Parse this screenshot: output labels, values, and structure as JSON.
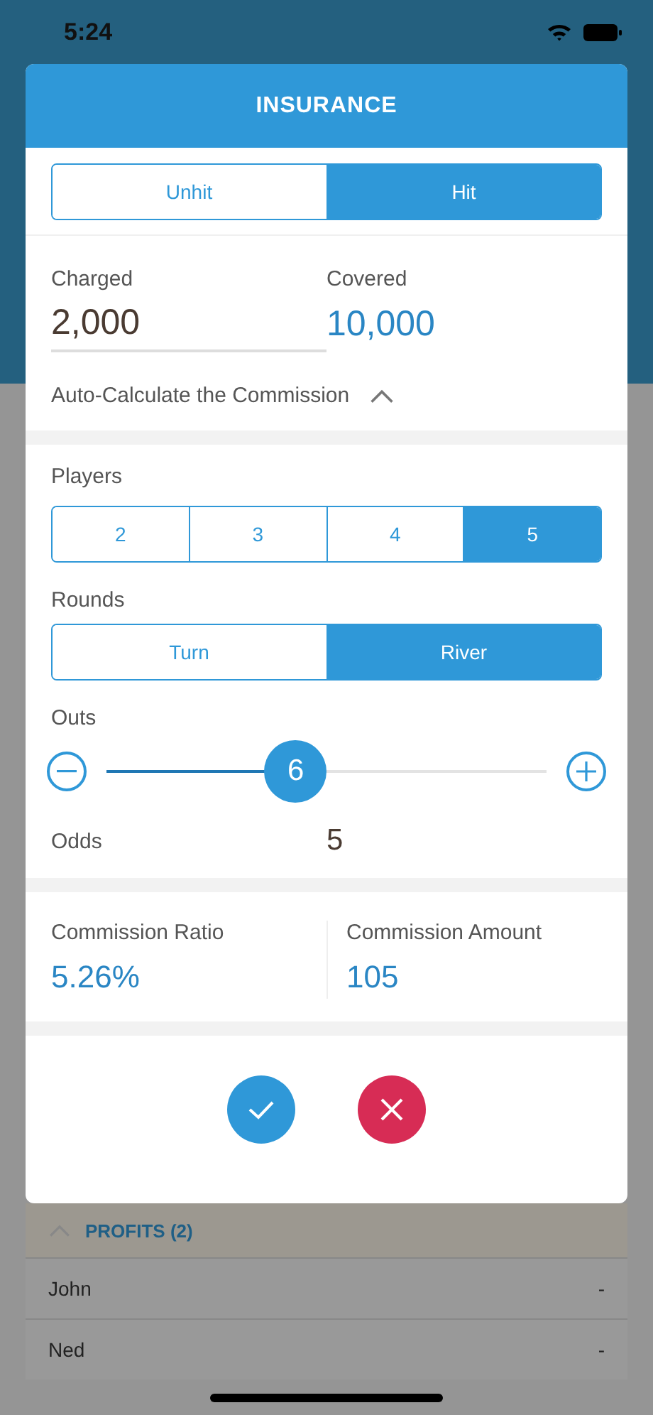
{
  "status_bar": {
    "time": "5:24"
  },
  "background": {
    "profits": {
      "title": "PROFITS (2)",
      "expanded": true
    },
    "rows": [
      {
        "name": "John",
        "value": "-"
      },
      {
        "name": "Ned",
        "value": "-"
      }
    ]
  },
  "dialog": {
    "title": "INSURANCE",
    "hit_options": [
      {
        "label": "Unhit",
        "selected": false
      },
      {
        "label": "Hit",
        "selected": true
      }
    ],
    "charged": {
      "label": "Charged",
      "value": "2,000"
    },
    "covered": {
      "label": "Covered",
      "value": "10,000"
    },
    "auto_calculate": {
      "label": "Auto-Calculate the Commission",
      "expanded": true
    },
    "players": {
      "label": "Players",
      "options": [
        {
          "label": "2",
          "selected": false
        },
        {
          "label": "3",
          "selected": false
        },
        {
          "label": "4",
          "selected": false
        },
        {
          "label": "5",
          "selected": true
        }
      ]
    },
    "rounds": {
      "label": "Rounds",
      "options": [
        {
          "label": "Turn",
          "selected": false
        },
        {
          "label": "River",
          "selected": true
        }
      ]
    },
    "outs": {
      "label": "Outs",
      "value": "6",
      "level": 0.43
    },
    "odds": {
      "label": "Odds",
      "value": "5"
    },
    "commission_ratio": {
      "label": "Commission Ratio",
      "value": "5.26%"
    },
    "commission_amount": {
      "label": "Commission Amount",
      "value": "105"
    }
  }
}
